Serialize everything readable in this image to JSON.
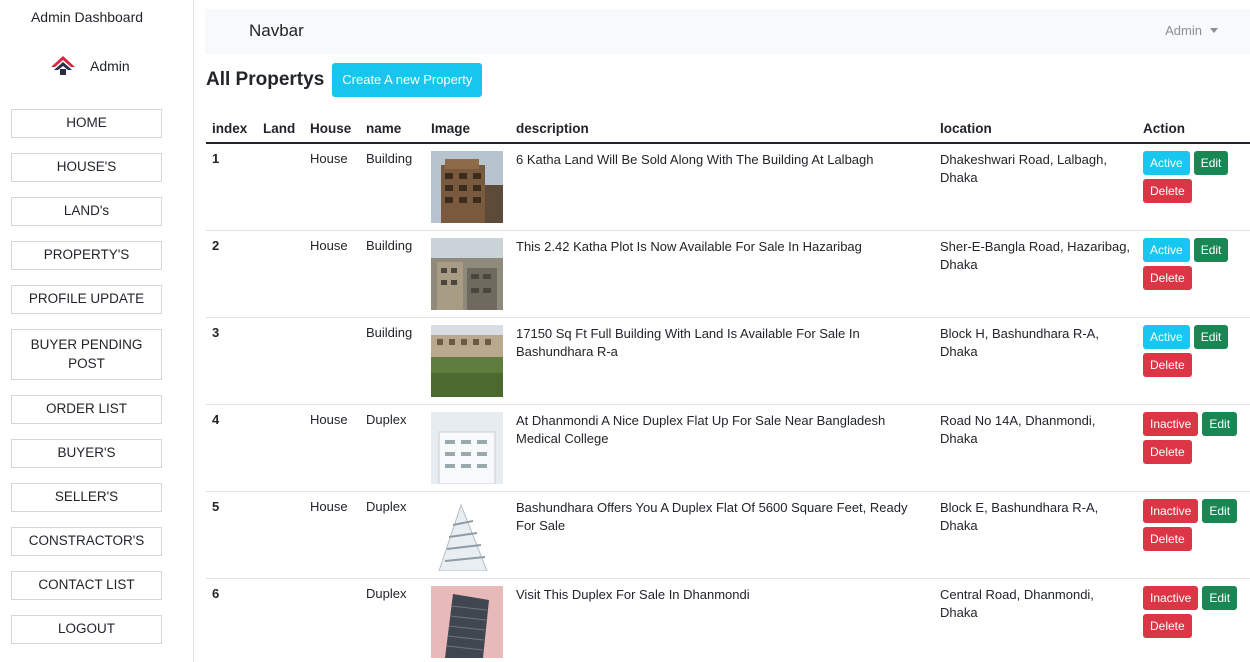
{
  "sidebar": {
    "title": "Admin Dashboard",
    "user": "Admin",
    "menu": [
      "HOME",
      "HOUSE'S",
      "LAND's",
      "PROPERTY'S",
      "PROFILE UPDATE",
      "BUYER PENDING POST",
      "ORDER LIST",
      "BUYER'S",
      "SELLER'S",
      "CONSTRACTOR'S",
      "CONTACT LIST",
      "LOGOUT"
    ]
  },
  "navbar": {
    "brand": "Navbar",
    "user": "Admin"
  },
  "page": {
    "title": "All Propertys",
    "create_label": "Create A new Property"
  },
  "table": {
    "headers": [
      "index",
      "Land",
      "House",
      "name",
      "Image",
      "description",
      "location",
      "Action"
    ],
    "rows": [
      {
        "index": "1",
        "land": "",
        "house": "House",
        "name": "Building",
        "description": "6 Katha Land Will Be Sold Along With The Building At Lalbagh",
        "location": "Dhakeshwari Road, Lalbagh, Dhaka",
        "status": "Active"
      },
      {
        "index": "2",
        "land": "",
        "house": "House",
        "name": "Building",
        "description": "This 2.42 Katha Plot Is Now Available For Sale In Hazaribag",
        "location": "Sher-E-Bangla Road, Hazaribag, Dhaka",
        "status": "Active"
      },
      {
        "index": "3",
        "land": "",
        "house": "",
        "name": "Building",
        "description": "17150 Sq Ft Full Building With Land Is Available For Sale In Bashundhara R-a",
        "location": "Block H, Bashundhara R-A, Dhaka",
        "status": "Active"
      },
      {
        "index": "4",
        "land": "",
        "house": "House",
        "name": "Duplex",
        "description": "At Dhanmondi A Nice Duplex Flat Up For Sale Near Bangladesh Medical College",
        "location": "Road No 14A, Dhanmondi, Dhaka",
        "status": "Inactive"
      },
      {
        "index": "5",
        "land": "",
        "house": "House",
        "name": "Duplex",
        "description": "Bashundhara Offers You A Duplex Flat Of 5600 Square Feet, Ready For Sale",
        "location": "Block E, Bashundhara R-A, Dhaka",
        "status": "Inactive"
      },
      {
        "index": "6",
        "land": "",
        "house": "",
        "name": "Duplex",
        "description": "Visit This Duplex For Sale In Dhanmondi",
        "location": "Central Road, Dhanmondi, Dhaka",
        "status": "Inactive"
      }
    ],
    "edit_label": "Edit",
    "delete_label": "Delete"
  },
  "colors": {
    "info": "#17c6ef",
    "danger": "#dc3545",
    "success": "#198754",
    "navbar_bg": "#f8f9fa"
  }
}
